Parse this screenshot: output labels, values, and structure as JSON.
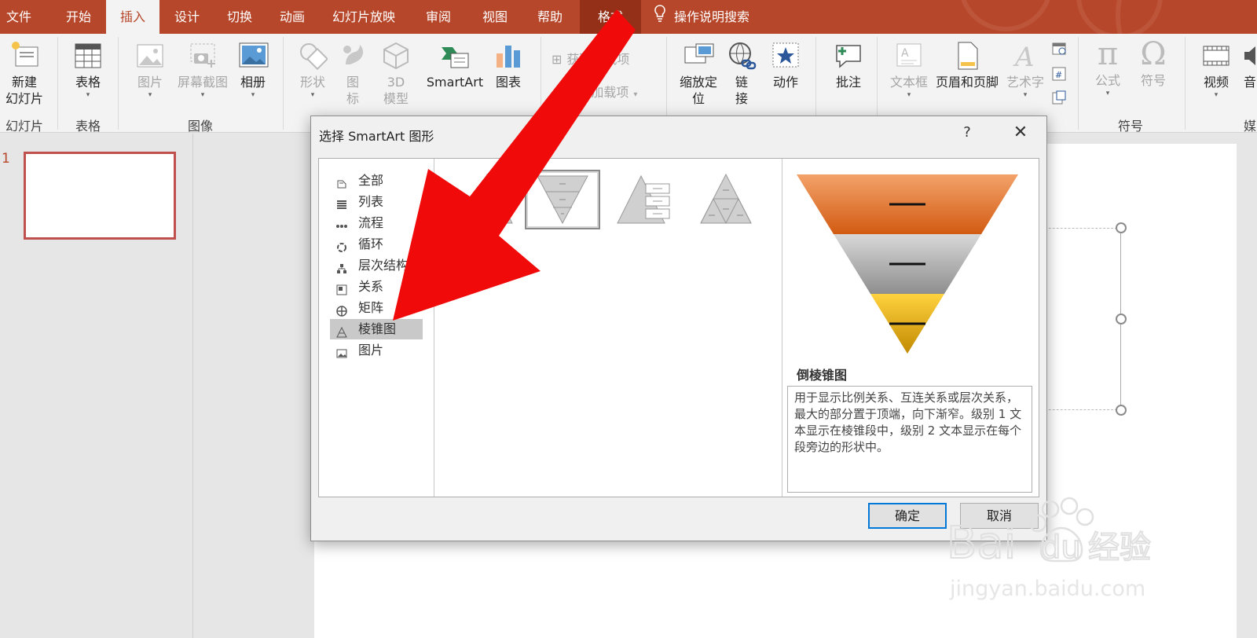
{
  "tabs": [
    {
      "label": "文件"
    },
    {
      "label": "开始"
    },
    {
      "label": "插入"
    },
    {
      "label": "设计"
    },
    {
      "label": "切换"
    },
    {
      "label": "动画"
    },
    {
      "label": "幻灯片放映"
    },
    {
      "label": "审阅"
    },
    {
      "label": "视图"
    },
    {
      "label": "帮助"
    },
    {
      "label": "格式"
    }
  ],
  "tell_me": "操作说明搜索",
  "ribbon": {
    "new_slide": "新建\n幻灯片",
    "new_slide_l1": "新建",
    "new_slide_l2": "幻灯片",
    "table": "表格",
    "picture": "图片",
    "screenshot": "屏幕截图",
    "album": "相册",
    "shapes": "形状",
    "icons_l1": "图",
    "icons_l2": "标",
    "model3d_l1": "3D",
    "model3d_l2": "模型",
    "smartart": "SmartArt",
    "chart": "图表",
    "get_addins": "获取加载项",
    "my_addins": "我的加载项",
    "zoom_l1": "缩放定",
    "zoom_l2": "位",
    "link_l1": "链",
    "link_l2": "接",
    "action": "动作",
    "comment": "批注",
    "textbox": "文本框",
    "header_footer": "页眉和页脚",
    "wordart": "艺术字",
    "equation": "公式",
    "symbol": "符号",
    "video": "视频",
    "audio": "音",
    "groups": {
      "slides": "幻灯片",
      "tables": "表格",
      "images": "图像",
      "symbols": "符号",
      "media": "媒"
    }
  },
  "slides": {
    "number": "1"
  },
  "dialog": {
    "title": "选择 SmartArt 图形",
    "help": "?",
    "categories": [
      {
        "label": "全部"
      },
      {
        "label": "列表"
      },
      {
        "label": "流程"
      },
      {
        "label": "循环"
      },
      {
        "label": "层次结构"
      },
      {
        "label": "关系"
      },
      {
        "label": "矩阵"
      },
      {
        "label": "棱锥图"
      },
      {
        "label": "图片"
      }
    ],
    "selected_category": "棱锥图",
    "preview_title": "倒棱锥图",
    "preview_description": "用于显示比例关系、互连关系或层次关系，最大的部分置于顶端，向下渐窄。级别 1 文本显示在棱锥段中，级别 2 文本显示在每个段旁边的形状中。",
    "ok": "确定",
    "cancel": "取消"
  },
  "watermark": {
    "brand": "Bai du 经验",
    "url": "jingyan.baidu.com"
  },
  "colors": {
    "accent": "#b7472a",
    "arrow": "#f00a0a",
    "selected": "#c9c9c9"
  }
}
